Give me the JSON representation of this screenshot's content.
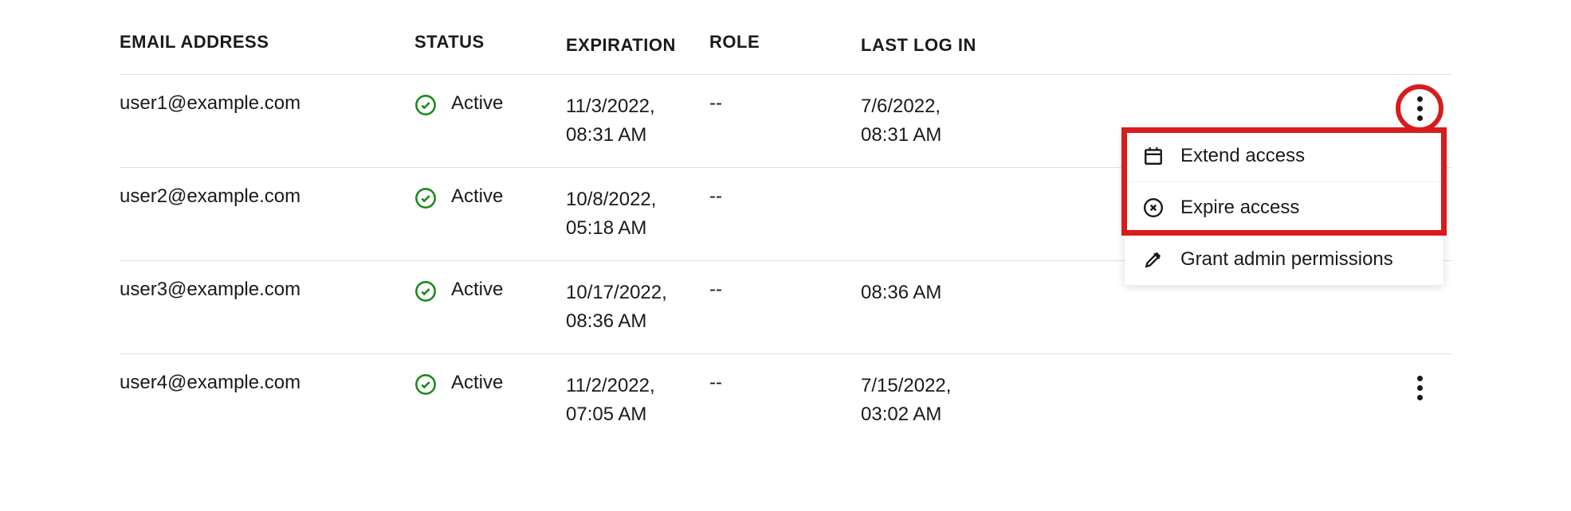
{
  "table": {
    "headers": {
      "email": "EMAIL ADDRESS",
      "status": "STATUS",
      "expiration": "EXPIRATION",
      "role": "ROLE",
      "lastlogin": "LAST LOG IN"
    },
    "rows": [
      {
        "email": "user1@example.com",
        "status": "Active",
        "expiration_date": "11/3/2022,",
        "expiration_time": "08:31 AM",
        "role": "--",
        "lastlogin_date": "7/6/2022,",
        "lastlogin_time": "08:31 AM"
      },
      {
        "email": "user2@example.com",
        "status": "Active",
        "expiration_date": "10/8/2022,",
        "expiration_time": "05:18 AM",
        "role": "--",
        "lastlogin_date": "",
        "lastlogin_time": ""
      },
      {
        "email": "user3@example.com",
        "status": "Active",
        "expiration_date": "10/17/2022,",
        "expiration_time": "08:36 AM",
        "role": "--",
        "lastlogin_date": "",
        "lastlogin_time": "08:36 AM"
      },
      {
        "email": "user4@example.com",
        "status": "Active",
        "expiration_date": "11/2/2022,",
        "expiration_time": "07:05 AM",
        "role": "--",
        "lastlogin_date": "7/15/2022,",
        "lastlogin_time": "03:02 AM"
      }
    ]
  },
  "menu": {
    "extend": "Extend access",
    "expire": "Expire access",
    "grant": "Grant admin permissions"
  }
}
